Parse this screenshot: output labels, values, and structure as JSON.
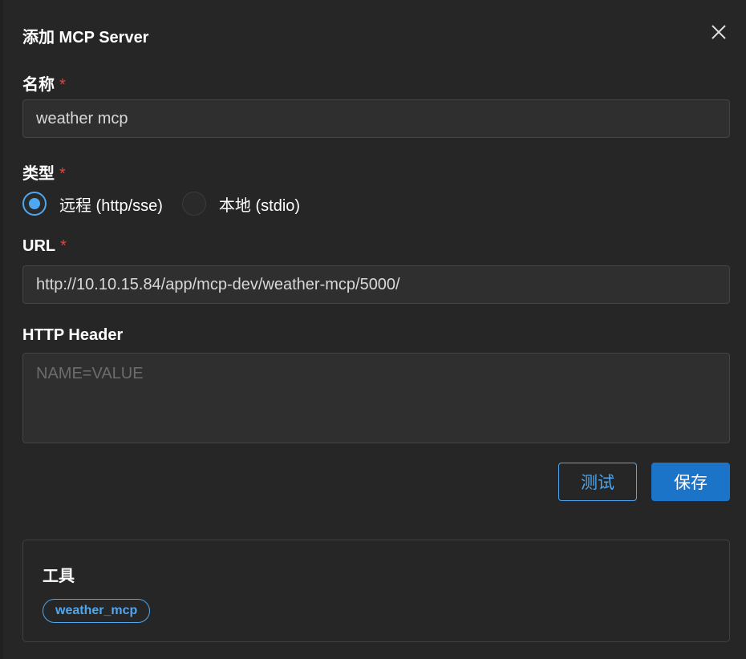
{
  "dialog": {
    "title": "添加 MCP Server",
    "close_icon": "close-icon"
  },
  "form": {
    "name": {
      "label": "名称",
      "required_mark": "*",
      "value": "weather mcp"
    },
    "type": {
      "label": "类型",
      "required_mark": "*",
      "options": [
        {
          "label": "远程 (http/sse)",
          "selected": true
        },
        {
          "label": "本地 (stdio)",
          "selected": false
        }
      ]
    },
    "url": {
      "label": "URL",
      "required_mark": "*",
      "value": "http://10.10.15.84/app/mcp-dev/weather-mcp/5000/"
    },
    "http_header": {
      "label": "HTTP Header",
      "placeholder": "NAME=VALUE",
      "value": ""
    }
  },
  "actions": {
    "test_label": "测试",
    "save_label": "保存"
  },
  "tools": {
    "title": "工具",
    "items": [
      "weather_mcp"
    ]
  },
  "colors": {
    "accent": "#4ea7f0",
    "primary_button": "#1c74c9",
    "required": "#e0453b",
    "background": "#262626"
  }
}
